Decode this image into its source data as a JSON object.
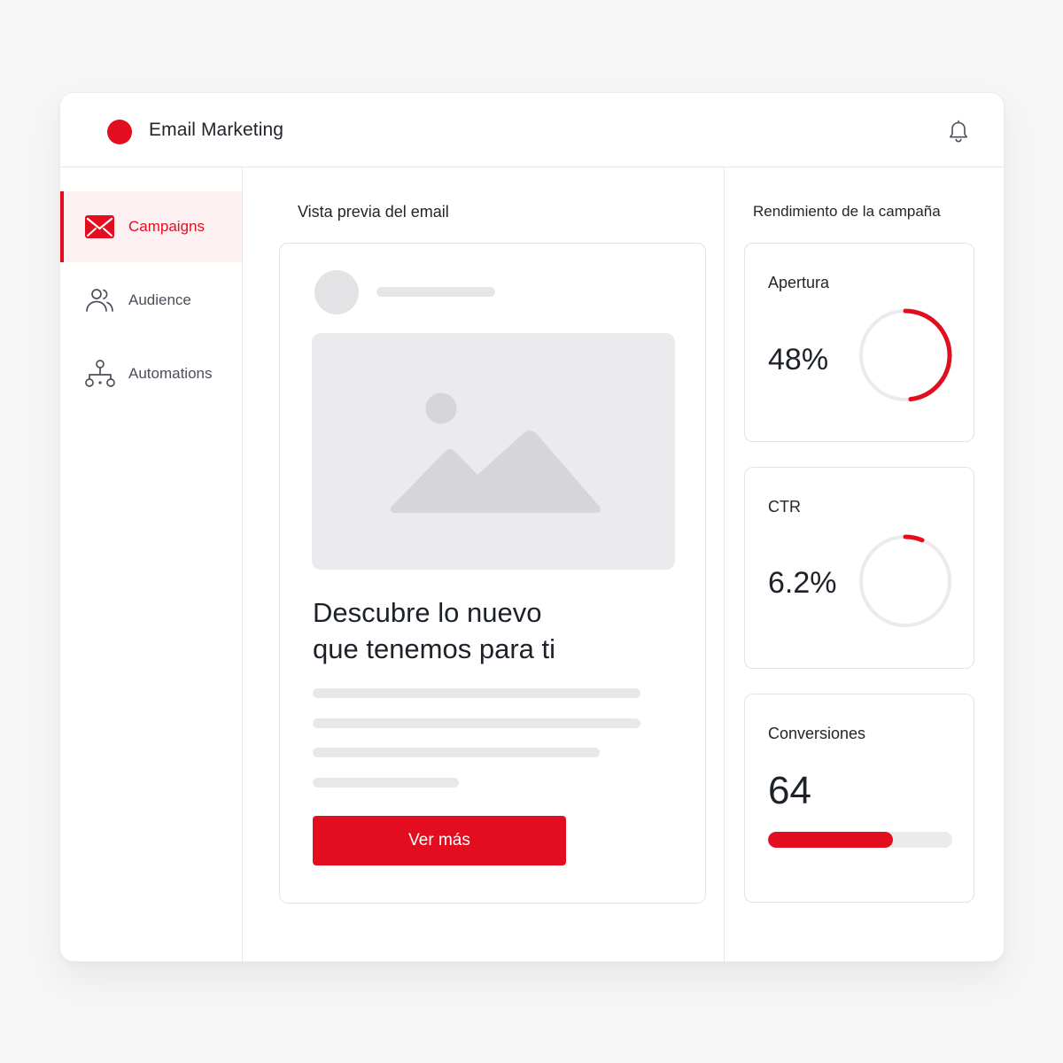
{
  "app": {
    "title": "Email Marketing"
  },
  "header": {
    "notifications_icon": "bell-icon"
  },
  "sidebar": {
    "items": [
      {
        "label": "Campaigns",
        "icon": "mail-icon",
        "active": true
      },
      {
        "label": "Audience",
        "icon": "users-icon",
        "active": false
      },
      {
        "label": "Automations",
        "icon": "workflow-icon",
        "active": false
      }
    ]
  },
  "preview": {
    "section_title": "Vista previa del email",
    "headline_line1": "Descubre lo nuevo",
    "headline_line2": "que tenemos para ti",
    "cta_label": "Ver más"
  },
  "performance": {
    "section_title": "Rendimiento de la campaña",
    "open_rate": {
      "label": "Apertura",
      "value": "48%",
      "fraction": 0.48
    },
    "ctr": {
      "label": "CTR",
      "value": "6.2%",
      "fraction": 0.062
    },
    "conversions": {
      "label": "Conversiones",
      "value": "64",
      "bar_fraction": 0.68
    }
  },
  "colors": {
    "accent": "#e30d20",
    "placeholder": "#e6e6e8",
    "track": "#ebebed"
  }
}
